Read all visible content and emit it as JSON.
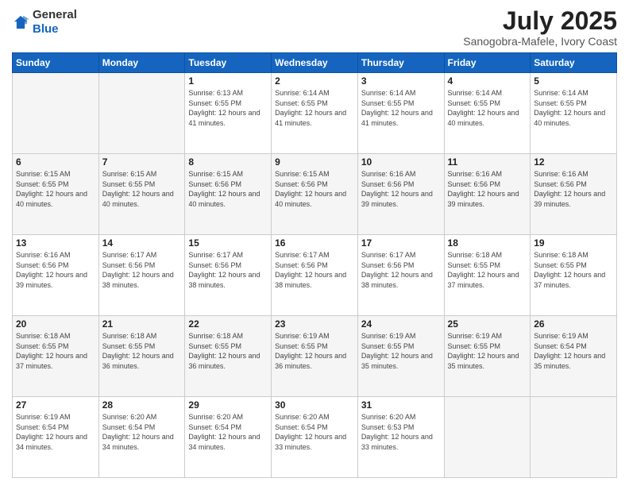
{
  "header": {
    "logo_general": "General",
    "logo_blue": "Blue",
    "title": "July 2025",
    "location": "Sanogobra-Mafele, Ivory Coast"
  },
  "weekdays": [
    "Sunday",
    "Monday",
    "Tuesday",
    "Wednesday",
    "Thursday",
    "Friday",
    "Saturday"
  ],
  "weeks": [
    [
      {
        "day": "",
        "info": ""
      },
      {
        "day": "",
        "info": ""
      },
      {
        "day": "1",
        "info": "Sunrise: 6:13 AM\nSunset: 6:55 PM\nDaylight: 12 hours and 41 minutes."
      },
      {
        "day": "2",
        "info": "Sunrise: 6:14 AM\nSunset: 6:55 PM\nDaylight: 12 hours and 41 minutes."
      },
      {
        "day": "3",
        "info": "Sunrise: 6:14 AM\nSunset: 6:55 PM\nDaylight: 12 hours and 41 minutes."
      },
      {
        "day": "4",
        "info": "Sunrise: 6:14 AM\nSunset: 6:55 PM\nDaylight: 12 hours and 40 minutes."
      },
      {
        "day": "5",
        "info": "Sunrise: 6:14 AM\nSunset: 6:55 PM\nDaylight: 12 hours and 40 minutes."
      }
    ],
    [
      {
        "day": "6",
        "info": "Sunrise: 6:15 AM\nSunset: 6:55 PM\nDaylight: 12 hours and 40 minutes."
      },
      {
        "day": "7",
        "info": "Sunrise: 6:15 AM\nSunset: 6:55 PM\nDaylight: 12 hours and 40 minutes."
      },
      {
        "day": "8",
        "info": "Sunrise: 6:15 AM\nSunset: 6:56 PM\nDaylight: 12 hours and 40 minutes."
      },
      {
        "day": "9",
        "info": "Sunrise: 6:15 AM\nSunset: 6:56 PM\nDaylight: 12 hours and 40 minutes."
      },
      {
        "day": "10",
        "info": "Sunrise: 6:16 AM\nSunset: 6:56 PM\nDaylight: 12 hours and 39 minutes."
      },
      {
        "day": "11",
        "info": "Sunrise: 6:16 AM\nSunset: 6:56 PM\nDaylight: 12 hours and 39 minutes."
      },
      {
        "day": "12",
        "info": "Sunrise: 6:16 AM\nSunset: 6:56 PM\nDaylight: 12 hours and 39 minutes."
      }
    ],
    [
      {
        "day": "13",
        "info": "Sunrise: 6:16 AM\nSunset: 6:56 PM\nDaylight: 12 hours and 39 minutes."
      },
      {
        "day": "14",
        "info": "Sunrise: 6:17 AM\nSunset: 6:56 PM\nDaylight: 12 hours and 38 minutes."
      },
      {
        "day": "15",
        "info": "Sunrise: 6:17 AM\nSunset: 6:56 PM\nDaylight: 12 hours and 38 minutes."
      },
      {
        "day": "16",
        "info": "Sunrise: 6:17 AM\nSunset: 6:56 PM\nDaylight: 12 hours and 38 minutes."
      },
      {
        "day": "17",
        "info": "Sunrise: 6:17 AM\nSunset: 6:56 PM\nDaylight: 12 hours and 38 minutes."
      },
      {
        "day": "18",
        "info": "Sunrise: 6:18 AM\nSunset: 6:55 PM\nDaylight: 12 hours and 37 minutes."
      },
      {
        "day": "19",
        "info": "Sunrise: 6:18 AM\nSunset: 6:55 PM\nDaylight: 12 hours and 37 minutes."
      }
    ],
    [
      {
        "day": "20",
        "info": "Sunrise: 6:18 AM\nSunset: 6:55 PM\nDaylight: 12 hours and 37 minutes."
      },
      {
        "day": "21",
        "info": "Sunrise: 6:18 AM\nSunset: 6:55 PM\nDaylight: 12 hours and 36 minutes."
      },
      {
        "day": "22",
        "info": "Sunrise: 6:18 AM\nSunset: 6:55 PM\nDaylight: 12 hours and 36 minutes."
      },
      {
        "day": "23",
        "info": "Sunrise: 6:19 AM\nSunset: 6:55 PM\nDaylight: 12 hours and 36 minutes."
      },
      {
        "day": "24",
        "info": "Sunrise: 6:19 AM\nSunset: 6:55 PM\nDaylight: 12 hours and 35 minutes."
      },
      {
        "day": "25",
        "info": "Sunrise: 6:19 AM\nSunset: 6:55 PM\nDaylight: 12 hours and 35 minutes."
      },
      {
        "day": "26",
        "info": "Sunrise: 6:19 AM\nSunset: 6:54 PM\nDaylight: 12 hours and 35 minutes."
      }
    ],
    [
      {
        "day": "27",
        "info": "Sunrise: 6:19 AM\nSunset: 6:54 PM\nDaylight: 12 hours and 34 minutes."
      },
      {
        "day": "28",
        "info": "Sunrise: 6:20 AM\nSunset: 6:54 PM\nDaylight: 12 hours and 34 minutes."
      },
      {
        "day": "29",
        "info": "Sunrise: 6:20 AM\nSunset: 6:54 PM\nDaylight: 12 hours and 34 minutes."
      },
      {
        "day": "30",
        "info": "Sunrise: 6:20 AM\nSunset: 6:54 PM\nDaylight: 12 hours and 33 minutes."
      },
      {
        "day": "31",
        "info": "Sunrise: 6:20 AM\nSunset: 6:53 PM\nDaylight: 12 hours and 33 minutes."
      },
      {
        "day": "",
        "info": ""
      },
      {
        "day": "",
        "info": ""
      }
    ]
  ]
}
